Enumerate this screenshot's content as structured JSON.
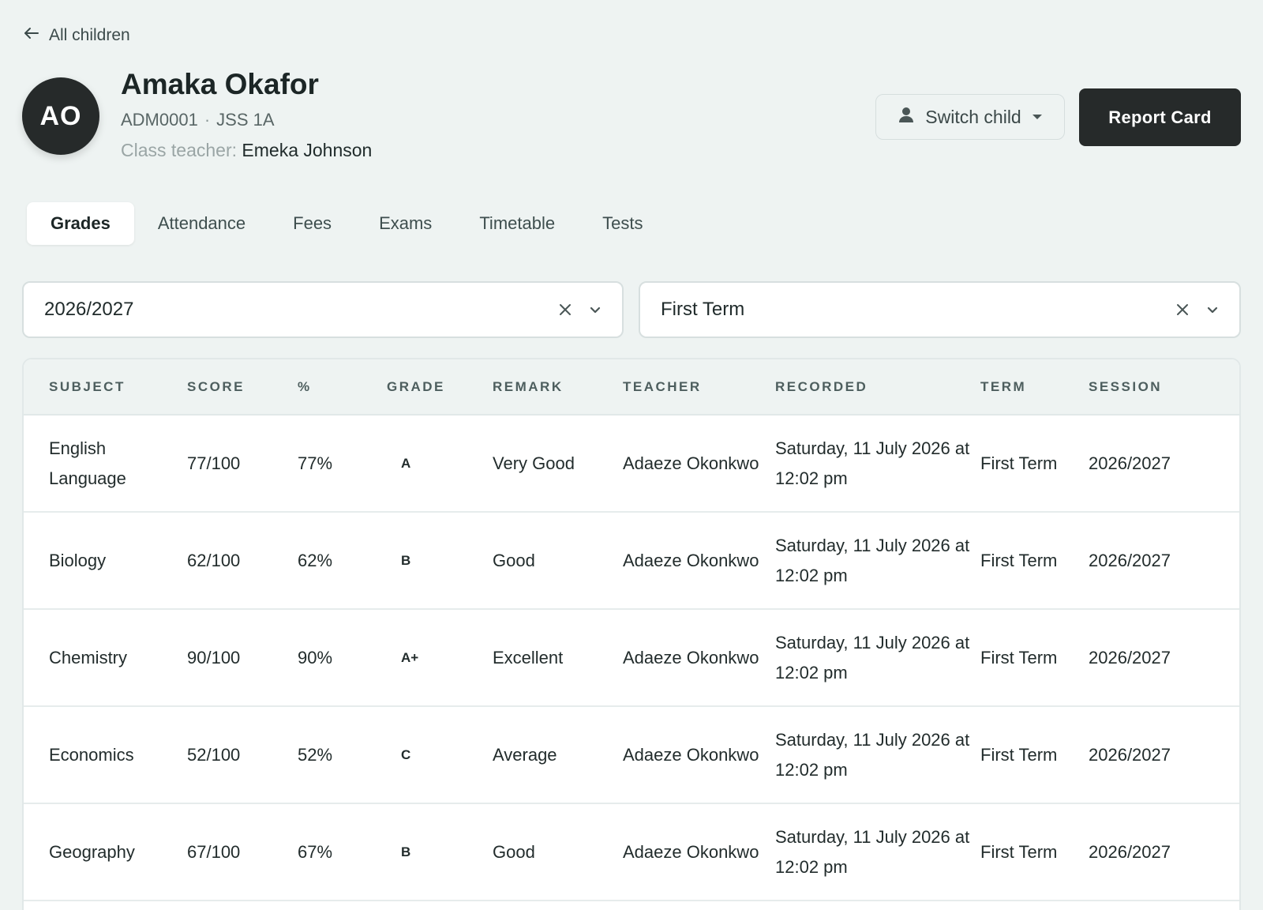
{
  "nav": {
    "back_label": "All children"
  },
  "student": {
    "initials": "AO",
    "name": "Amaka Okafor",
    "admission_no": "ADM0001",
    "meta_separator": "·",
    "class": "JSS 1A",
    "teacher_label": "Class teacher:",
    "teacher_name": "Emeka Johnson"
  },
  "actions": {
    "switch_child_label": "Switch child",
    "report_card_label": "Report Card"
  },
  "tabs": [
    {
      "label": "Grades",
      "active": true
    },
    {
      "label": "Attendance",
      "active": false
    },
    {
      "label": "Fees",
      "active": false
    },
    {
      "label": "Exams",
      "active": false
    },
    {
      "label": "Timetable",
      "active": false
    },
    {
      "label": "Tests",
      "active": false
    }
  ],
  "filters": {
    "session": "2026/2027",
    "term": "First Term"
  },
  "table": {
    "headers": [
      "SUBJECT",
      "SCORE",
      "%",
      "GRADE",
      "REMARK",
      "TEACHER",
      "RECORDED",
      "TERM",
      "SESSION"
    ],
    "rows": [
      {
        "subject": "English Language",
        "score": "77/100",
        "percent": "77%",
        "grade": "A",
        "remark": "Very Good",
        "teacher": "Adaeze Okonkwo",
        "recorded": "Saturday, 11 July 2026 at 12:02 pm",
        "term": "First Term",
        "session": "2026/2027"
      },
      {
        "subject": "Biology",
        "score": "62/100",
        "percent": "62%",
        "grade": "B",
        "remark": "Good",
        "teacher": "Adaeze Okonkwo",
        "recorded": "Saturday, 11 July 2026 at 12:02 pm",
        "term": "First Term",
        "session": "2026/2027"
      },
      {
        "subject": "Chemistry",
        "score": "90/100",
        "percent": "90%",
        "grade": "A+",
        "remark": "Excellent",
        "teacher": "Adaeze Okonkwo",
        "recorded": "Saturday, 11 July 2026 at 12:02 pm",
        "term": "First Term",
        "session": "2026/2027"
      },
      {
        "subject": "Economics",
        "score": "52/100",
        "percent": "52%",
        "grade": "C",
        "remark": "Average",
        "teacher": "Adaeze Okonkwo",
        "recorded": "Saturday, 11 July 2026 at 12:02 pm",
        "term": "First Term",
        "session": "2026/2027"
      },
      {
        "subject": "Geography",
        "score": "67/100",
        "percent": "67%",
        "grade": "B",
        "remark": "Good",
        "teacher": "Adaeze Okonkwo",
        "recorded": "Saturday, 11 July 2026 at 12:02 pm",
        "term": "First Term",
        "session": "2026/2027"
      }
    ]
  },
  "icons": {
    "back": "arrow-left-icon",
    "switch": "person-icon",
    "caret": "caret-down-icon",
    "clear": "close-icon",
    "chevron": "chevron-down-icon"
  }
}
